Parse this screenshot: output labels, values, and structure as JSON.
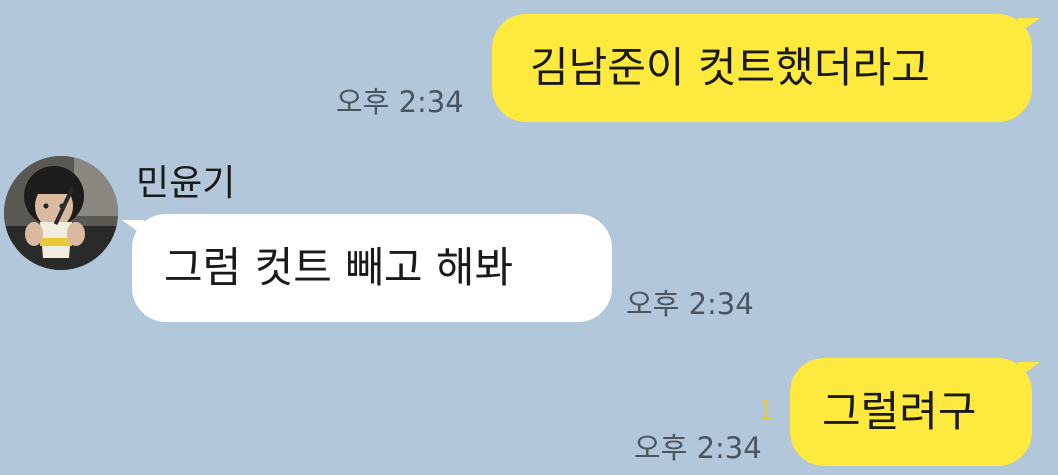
{
  "colors": {
    "background": "#b2c7d9",
    "my_bubble": "#fee93f",
    "other_bubble": "#ffffff",
    "unread": "#e8c832"
  },
  "messages": [
    {
      "from": "me",
      "text": "김남준이 컷트했더라고",
      "time": "오후 2:34"
    },
    {
      "from": "other",
      "sender": "민윤기",
      "avatar": "profile-photo",
      "text": "그럼 컷트 빼고 해봐",
      "time": "오후 2:34"
    },
    {
      "from": "me",
      "text": "그럴려구",
      "time": "오후 2:34",
      "unread": "1"
    }
  ]
}
